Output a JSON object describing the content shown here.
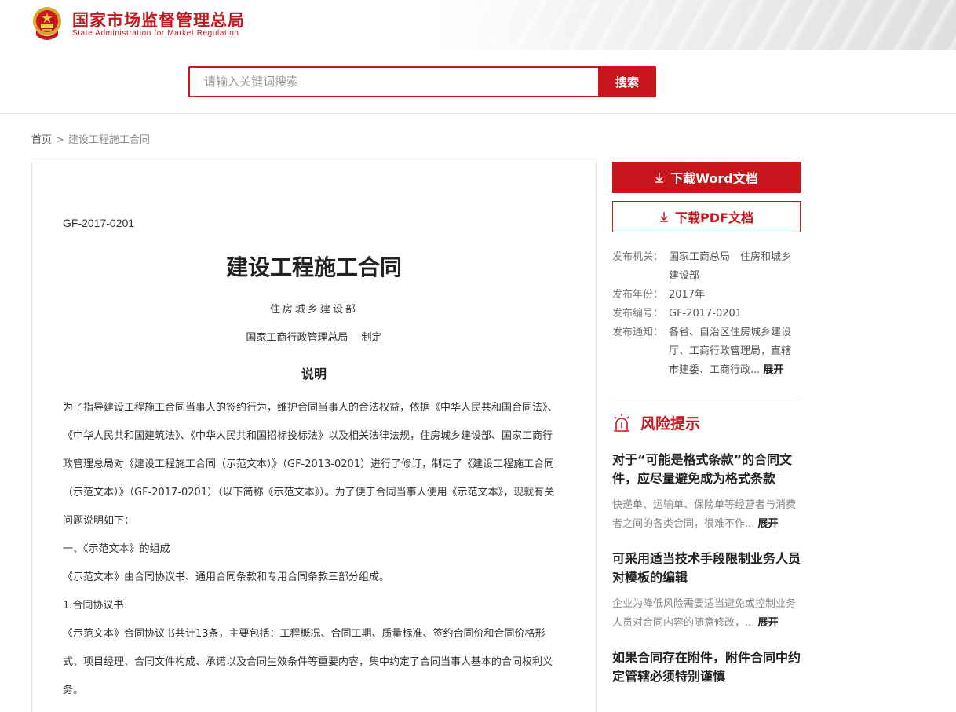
{
  "header": {
    "brand_cn": "国家市场监督管理总局",
    "brand_en": "State Administration for Market Regulation",
    "accent_color": "#c8161d",
    "logo_icon": "national-emblem-icon"
  },
  "search": {
    "placeholder": "请输入关键词搜索",
    "value": "",
    "button_label": "搜索"
  },
  "breadcrumb": {
    "home": "首页",
    "separator": ">",
    "current": "建设工程施工合同"
  },
  "document": {
    "code": "GF-2017-0201",
    "title": "建设工程施工合同",
    "issuer_line1": "住房城乡建设部",
    "issuer_line2": "国家工商行政管理总局　 制定",
    "section_heading": "说明",
    "paragraphs": [
      "为了指导建设工程施工合同当事人的签约行为，维护合同当事人的合法权益，依据《中华人民共和国合同法》、《中华人民共和国建筑法》、《中华人民共和国招标投标法》以及相关法律法规，住房城乡建设部、国家工商行政管理总局对《建设工程施工合同（示范文本）》（GF-2013-0201）进行了修订，制定了《建设工程施工合同（示范文本）》（GF-2017-0201）（以下简称《示范文本》）。为了便于合同当事人使用《示范文本》，现就有关问题说明如下：",
      "一、《示范文本》的组成",
      "《示范文本》由合同协议书、通用合同条款和专用合同条款三部分组成。",
      "1.合同协议书",
      "《示范文本》合同协议书共计13条，主要包括：工程概况、合同工期、质量标准、签约合同价和合同价格形式、项目经理、合同文件构成、承诺以及合同生效条件等重要内容，集中约定了合同当事人基本的合同权利义务。"
    ]
  },
  "downloads": {
    "word_label": "下载Word文档",
    "pdf_label": "下载PDF文档",
    "icon": "download-arrow-icon"
  },
  "meta": {
    "publisher_key": "发布机关：",
    "publisher_val": "国家工商总局　住房和城乡建设部",
    "year_key": "发布年份：",
    "year_val": "2017年",
    "code_key": "发布编号：",
    "code_val": "GF-2017-0201",
    "notice_key": "发布通知：",
    "notice_val": "各省、自治区住房城乡建设厅、工商行政管理局，直辖市建委、工商行政...",
    "expand_label": "展开"
  },
  "risk": {
    "heading": "风险提示",
    "icon": "alarm-light-icon",
    "items": [
      {
        "title": "对于“可能是格式条款”的合同文件，应尽量避免成为格式条款",
        "desc": "快递单、运输单、保险单等经营者与消费者之间的各类合同，很难不作...",
        "expand": "展开"
      },
      {
        "title": "可采用适当技术手段限制业务人员对模板的编辑",
        "desc": "企业为降低风险需要适当避免或控制业务人员对合同内容的随意修改，...",
        "expand": "展开"
      },
      {
        "title": "如果合同存在附件，附件合同中约定管辖必须特别谨慎",
        "desc": "",
        "expand": ""
      }
    ]
  }
}
